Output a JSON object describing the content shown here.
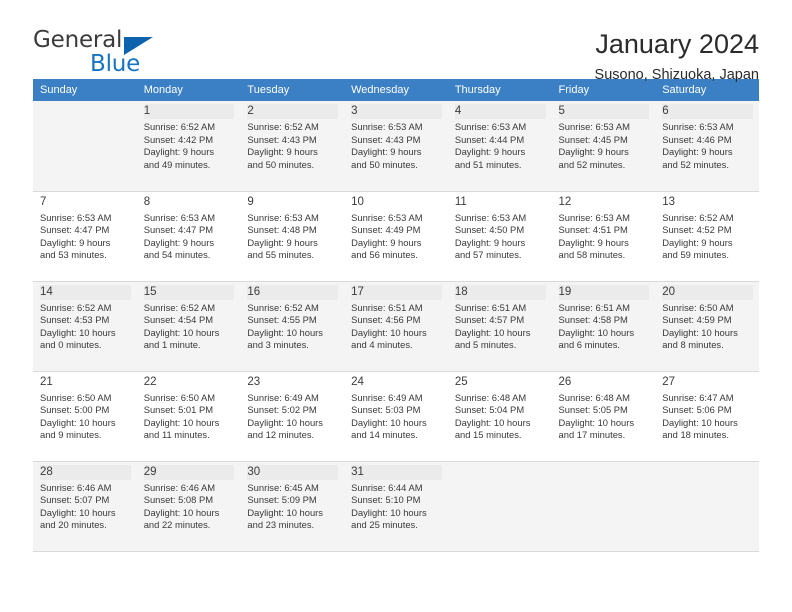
{
  "brand": {
    "name_top": "General",
    "name_bottom": "Blue",
    "triangle_color": "#0d63ad",
    "blue_color": "#1773c4"
  },
  "header": {
    "title": "January 2024",
    "subtitle": "Susono, Shizuoka, Japan"
  },
  "theme": {
    "header_band": "#3b7fc4",
    "row_shade": "#f4f4f4",
    "daynum_shade": "#ebebeb",
    "grid_line": "#d9d9d9"
  },
  "weekdays": [
    "Sunday",
    "Monday",
    "Tuesday",
    "Wednesday",
    "Thursday",
    "Friday",
    "Saturday"
  ],
  "weeks": [
    [
      {
        "day": "",
        "sunrise": "",
        "sunset": "",
        "daylight1": "",
        "daylight2": ""
      },
      {
        "day": "1",
        "sunrise": "Sunrise: 6:52 AM",
        "sunset": "Sunset: 4:42 PM",
        "daylight1": "Daylight: 9 hours",
        "daylight2": "and 49 minutes."
      },
      {
        "day": "2",
        "sunrise": "Sunrise: 6:52 AM",
        "sunset": "Sunset: 4:43 PM",
        "daylight1": "Daylight: 9 hours",
        "daylight2": "and 50 minutes."
      },
      {
        "day": "3",
        "sunrise": "Sunrise: 6:53 AM",
        "sunset": "Sunset: 4:43 PM",
        "daylight1": "Daylight: 9 hours",
        "daylight2": "and 50 minutes."
      },
      {
        "day": "4",
        "sunrise": "Sunrise: 6:53 AM",
        "sunset": "Sunset: 4:44 PM",
        "daylight1": "Daylight: 9 hours",
        "daylight2": "and 51 minutes."
      },
      {
        "day": "5",
        "sunrise": "Sunrise: 6:53 AM",
        "sunset": "Sunset: 4:45 PM",
        "daylight1": "Daylight: 9 hours",
        "daylight2": "and 52 minutes."
      },
      {
        "day": "6",
        "sunrise": "Sunrise: 6:53 AM",
        "sunset": "Sunset: 4:46 PM",
        "daylight1": "Daylight: 9 hours",
        "daylight2": "and 52 minutes."
      }
    ],
    [
      {
        "day": "7",
        "sunrise": "Sunrise: 6:53 AM",
        "sunset": "Sunset: 4:47 PM",
        "daylight1": "Daylight: 9 hours",
        "daylight2": "and 53 minutes."
      },
      {
        "day": "8",
        "sunrise": "Sunrise: 6:53 AM",
        "sunset": "Sunset: 4:47 PM",
        "daylight1": "Daylight: 9 hours",
        "daylight2": "and 54 minutes."
      },
      {
        "day": "9",
        "sunrise": "Sunrise: 6:53 AM",
        "sunset": "Sunset: 4:48 PM",
        "daylight1": "Daylight: 9 hours",
        "daylight2": "and 55 minutes."
      },
      {
        "day": "10",
        "sunrise": "Sunrise: 6:53 AM",
        "sunset": "Sunset: 4:49 PM",
        "daylight1": "Daylight: 9 hours",
        "daylight2": "and 56 minutes."
      },
      {
        "day": "11",
        "sunrise": "Sunrise: 6:53 AM",
        "sunset": "Sunset: 4:50 PM",
        "daylight1": "Daylight: 9 hours",
        "daylight2": "and 57 minutes."
      },
      {
        "day": "12",
        "sunrise": "Sunrise: 6:53 AM",
        "sunset": "Sunset: 4:51 PM",
        "daylight1": "Daylight: 9 hours",
        "daylight2": "and 58 minutes."
      },
      {
        "day": "13",
        "sunrise": "Sunrise: 6:52 AM",
        "sunset": "Sunset: 4:52 PM",
        "daylight1": "Daylight: 9 hours",
        "daylight2": "and 59 minutes."
      }
    ],
    [
      {
        "day": "14",
        "sunrise": "Sunrise: 6:52 AM",
        "sunset": "Sunset: 4:53 PM",
        "daylight1": "Daylight: 10 hours",
        "daylight2": "and 0 minutes."
      },
      {
        "day": "15",
        "sunrise": "Sunrise: 6:52 AM",
        "sunset": "Sunset: 4:54 PM",
        "daylight1": "Daylight: 10 hours",
        "daylight2": "and 1 minute."
      },
      {
        "day": "16",
        "sunrise": "Sunrise: 6:52 AM",
        "sunset": "Sunset: 4:55 PM",
        "daylight1": "Daylight: 10 hours",
        "daylight2": "and 3 minutes."
      },
      {
        "day": "17",
        "sunrise": "Sunrise: 6:51 AM",
        "sunset": "Sunset: 4:56 PM",
        "daylight1": "Daylight: 10 hours",
        "daylight2": "and 4 minutes."
      },
      {
        "day": "18",
        "sunrise": "Sunrise: 6:51 AM",
        "sunset": "Sunset: 4:57 PM",
        "daylight1": "Daylight: 10 hours",
        "daylight2": "and 5 minutes."
      },
      {
        "day": "19",
        "sunrise": "Sunrise: 6:51 AM",
        "sunset": "Sunset: 4:58 PM",
        "daylight1": "Daylight: 10 hours",
        "daylight2": "and 6 minutes."
      },
      {
        "day": "20",
        "sunrise": "Sunrise: 6:50 AM",
        "sunset": "Sunset: 4:59 PM",
        "daylight1": "Daylight: 10 hours",
        "daylight2": "and 8 minutes."
      }
    ],
    [
      {
        "day": "21",
        "sunrise": "Sunrise: 6:50 AM",
        "sunset": "Sunset: 5:00 PM",
        "daylight1": "Daylight: 10 hours",
        "daylight2": "and 9 minutes."
      },
      {
        "day": "22",
        "sunrise": "Sunrise: 6:50 AM",
        "sunset": "Sunset: 5:01 PM",
        "daylight1": "Daylight: 10 hours",
        "daylight2": "and 11 minutes."
      },
      {
        "day": "23",
        "sunrise": "Sunrise: 6:49 AM",
        "sunset": "Sunset: 5:02 PM",
        "daylight1": "Daylight: 10 hours",
        "daylight2": "and 12 minutes."
      },
      {
        "day": "24",
        "sunrise": "Sunrise: 6:49 AM",
        "sunset": "Sunset: 5:03 PM",
        "daylight1": "Daylight: 10 hours",
        "daylight2": "and 14 minutes."
      },
      {
        "day": "25",
        "sunrise": "Sunrise: 6:48 AM",
        "sunset": "Sunset: 5:04 PM",
        "daylight1": "Daylight: 10 hours",
        "daylight2": "and 15 minutes."
      },
      {
        "day": "26",
        "sunrise": "Sunrise: 6:48 AM",
        "sunset": "Sunset: 5:05 PM",
        "daylight1": "Daylight: 10 hours",
        "daylight2": "and 17 minutes."
      },
      {
        "day": "27",
        "sunrise": "Sunrise: 6:47 AM",
        "sunset": "Sunset: 5:06 PM",
        "daylight1": "Daylight: 10 hours",
        "daylight2": "and 18 minutes."
      }
    ],
    [
      {
        "day": "28",
        "sunrise": "Sunrise: 6:46 AM",
        "sunset": "Sunset: 5:07 PM",
        "daylight1": "Daylight: 10 hours",
        "daylight2": "and 20 minutes."
      },
      {
        "day": "29",
        "sunrise": "Sunrise: 6:46 AM",
        "sunset": "Sunset: 5:08 PM",
        "daylight1": "Daylight: 10 hours",
        "daylight2": "and 22 minutes."
      },
      {
        "day": "30",
        "sunrise": "Sunrise: 6:45 AM",
        "sunset": "Sunset: 5:09 PM",
        "daylight1": "Daylight: 10 hours",
        "daylight2": "and 23 minutes."
      },
      {
        "day": "31",
        "sunrise": "Sunrise: 6:44 AM",
        "sunset": "Sunset: 5:10 PM",
        "daylight1": "Daylight: 10 hours",
        "daylight2": "and 25 minutes."
      },
      {
        "day": "",
        "sunrise": "",
        "sunset": "",
        "daylight1": "",
        "daylight2": ""
      },
      {
        "day": "",
        "sunrise": "",
        "sunset": "",
        "daylight1": "",
        "daylight2": ""
      },
      {
        "day": "",
        "sunrise": "",
        "sunset": "",
        "daylight1": "",
        "daylight2": ""
      }
    ]
  ]
}
